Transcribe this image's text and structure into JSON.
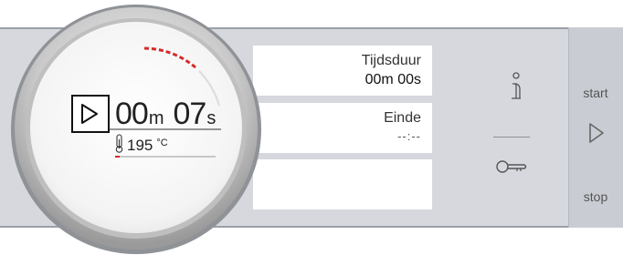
{
  "dial": {
    "minutes": "00",
    "minutes_unit": "m",
    "seconds": "07",
    "seconds_unit": "s",
    "temperature": "195",
    "temperature_unit": "°C",
    "play_icon": "play-icon",
    "thermometer_icon": "thermometer-icon"
  },
  "fields": [
    {
      "label": "Tijdsduur",
      "value": "00m 00s"
    },
    {
      "label": "Einde",
      "value": "--:--"
    },
    {
      "label": "",
      "value": ""
    }
  ],
  "middle": {
    "top_icon": "info-icon",
    "bottom_icon": "key-lock-icon"
  },
  "side": {
    "start_label": "start",
    "stop_label": "stop",
    "icon": "play-outline-icon"
  },
  "colors": {
    "panel": "#d6d8de",
    "side_panel": "#c9ccd2",
    "accent_red": "#d42a2a",
    "field_bg": "#ffffff"
  }
}
